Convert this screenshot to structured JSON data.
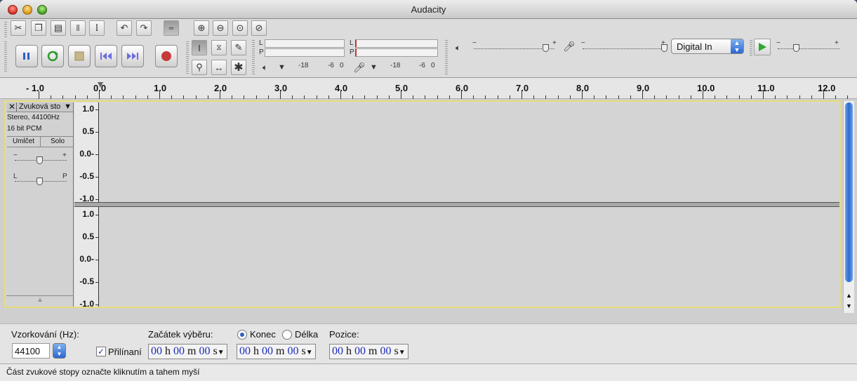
{
  "window": {
    "title": "Audacity"
  },
  "toolbar": {
    "meter_play_left": "L",
    "meter_play_right": "P",
    "meter_rec_left": "L",
    "meter_rec_right": "P",
    "meter_scale_a": "-18",
    "meter_scale_b": "-6",
    "meter_scale_c": "0",
    "meter_scale_d": "-18",
    "meter_scale_e": "-6",
    "meter_scale_f": "0",
    "slider_minus": "−",
    "slider_plus": "+",
    "input_device": "Digital In"
  },
  "ruler": {
    "ticks": [
      "- 1.0",
      "0.0",
      "1.0",
      "2.0",
      "3.0",
      "4.0",
      "5.0",
      "6.0",
      "7.0",
      "8.0",
      "9.0",
      "10.0",
      "11.0",
      "12.0"
    ]
  },
  "track": {
    "name": "Zvuková sto",
    "info_line1": "Stereo, 44100Hz",
    "info_line2": "16 bit PCM",
    "mute_label": "Umlčet",
    "solo_label": "Solo",
    "gain_minus": "−",
    "gain_plus": "+",
    "pan_left": "L",
    "pan_right": "P",
    "scale": [
      "1.0",
      "0.5",
      "0.0-",
      "-0.5",
      "-1.0"
    ]
  },
  "selection_bar": {
    "rate_label": "Vzorkování (Hz):",
    "rate_value": "44100",
    "snap_label": "Přilínaní",
    "start_label": "Začátek výběru:",
    "end_label": "Konec",
    "length_label": "Délka",
    "position_label": "Pozice:",
    "time_hh": "00",
    "time_h": "h",
    "time_mm": "00",
    "time_m": "m",
    "time_ss": "00",
    "time_s": "s"
  },
  "status": {
    "text": "Část zvukové stopy označte kliknutím a tahem myší"
  }
}
